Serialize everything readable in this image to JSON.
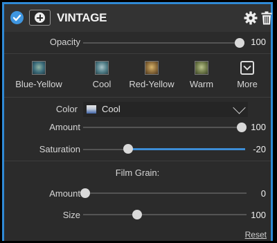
{
  "header": {
    "title": "VINTAGE",
    "icons": [
      "checkmark-icon",
      "add-circle-icon",
      "gear-icon",
      "trash-icon"
    ]
  },
  "opacity": {
    "label": "Opacity",
    "value": "100",
    "level": 1.0
  },
  "presets": [
    {
      "label": "Blue-Yellow",
      "thumb_color": "#3b6b7a"
    },
    {
      "label": "Cool",
      "thumb_color": "#4f7c86"
    },
    {
      "label": "Red-Yellow",
      "thumb_color": "#8a6a3a"
    },
    {
      "label": "Warm",
      "thumb_color": "#6f7a4a"
    },
    {
      "label": "More",
      "icon": "chevron-down-box-icon"
    }
  ],
  "color": {
    "label": "Color",
    "selected": "Cool"
  },
  "amount": {
    "label": "Amount",
    "value": "100",
    "level": 1.0
  },
  "saturation": {
    "label": "Saturation",
    "value": "-20",
    "level": 0.3
  },
  "film_grain": {
    "heading": "Film Grain:",
    "amount": {
      "label": "Amount",
      "value": "0",
      "level": 0.0
    },
    "size": {
      "label": "Size",
      "value": "100",
      "level": 0.33
    }
  },
  "reset_label": "Reset",
  "colors": {
    "accent": "#3d8dd6",
    "panel": "#2b2b2b",
    "border": "#2f8ad6"
  }
}
